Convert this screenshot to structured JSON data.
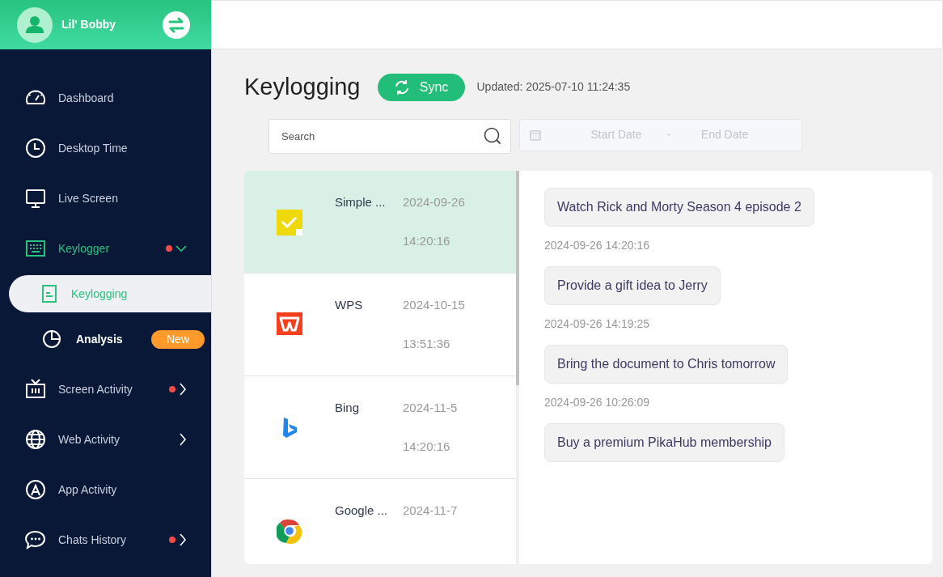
{
  "user": {
    "name": "Lil' Bobby"
  },
  "nav": [
    {
      "label": "Dashboard",
      "expandable": false,
      "expanded": false,
      "dot": false
    },
    {
      "label": "Desktop Time",
      "expandable": false,
      "expanded": false,
      "dot": false
    },
    {
      "label": "Live Screen",
      "expandable": false,
      "expanded": false,
      "dot": false
    },
    {
      "label": "Keylogger",
      "expandable": true,
      "expanded": true,
      "dot": true,
      "children": [
        {
          "label": "Keylogging",
          "selected": true
        },
        {
          "label": "Analysis",
          "selected": false,
          "badge": "New"
        }
      ]
    },
    {
      "label": "Screen Activity",
      "expandable": true,
      "expanded": false,
      "dot": true
    },
    {
      "label": "Web Activity",
      "expandable": true,
      "expanded": false,
      "dot": false
    },
    {
      "label": "App Activity",
      "expandable": false,
      "expanded": false,
      "dot": false
    },
    {
      "label": "Chats History",
      "expandable": true,
      "expanded": false,
      "dot": true
    }
  ],
  "page": {
    "title": "Keylogging",
    "sync_button": "Sync",
    "updated": "Updated: 2025-07-10 11:24:35"
  },
  "search": {
    "placeholder": "Search"
  },
  "date_range": {
    "start_placeholder": "Start Date",
    "separator": "-",
    "end_placeholder": "End Date",
    "disabled": true
  },
  "apps": [
    {
      "name": "Simple ...",
      "date": "2024-09-26",
      "time": "14:20:16",
      "selected": true
    },
    {
      "name": "WPS",
      "date": "2024-10-15",
      "time": "13:51:36",
      "selected": false
    },
    {
      "name": "Bing",
      "date": "2024-11-5",
      "time": "14:20:16",
      "selected": false
    },
    {
      "name": "Google ...",
      "date": "2024-11-7",
      "selected": false
    }
  ],
  "entries": [
    {
      "text": "Watch Rick and Morty Season 4 episode 2",
      "time": "2024-09-26 14:20:16"
    },
    {
      "text": "Provide a gift idea to Jerry",
      "time": "2024-09-26 14:19:25"
    },
    {
      "text": "Bring the document to Chris tomorrow",
      "time": "2024-09-26 10:26:09"
    },
    {
      "text": "Buy a premium PikaHub membership"
    }
  ]
}
